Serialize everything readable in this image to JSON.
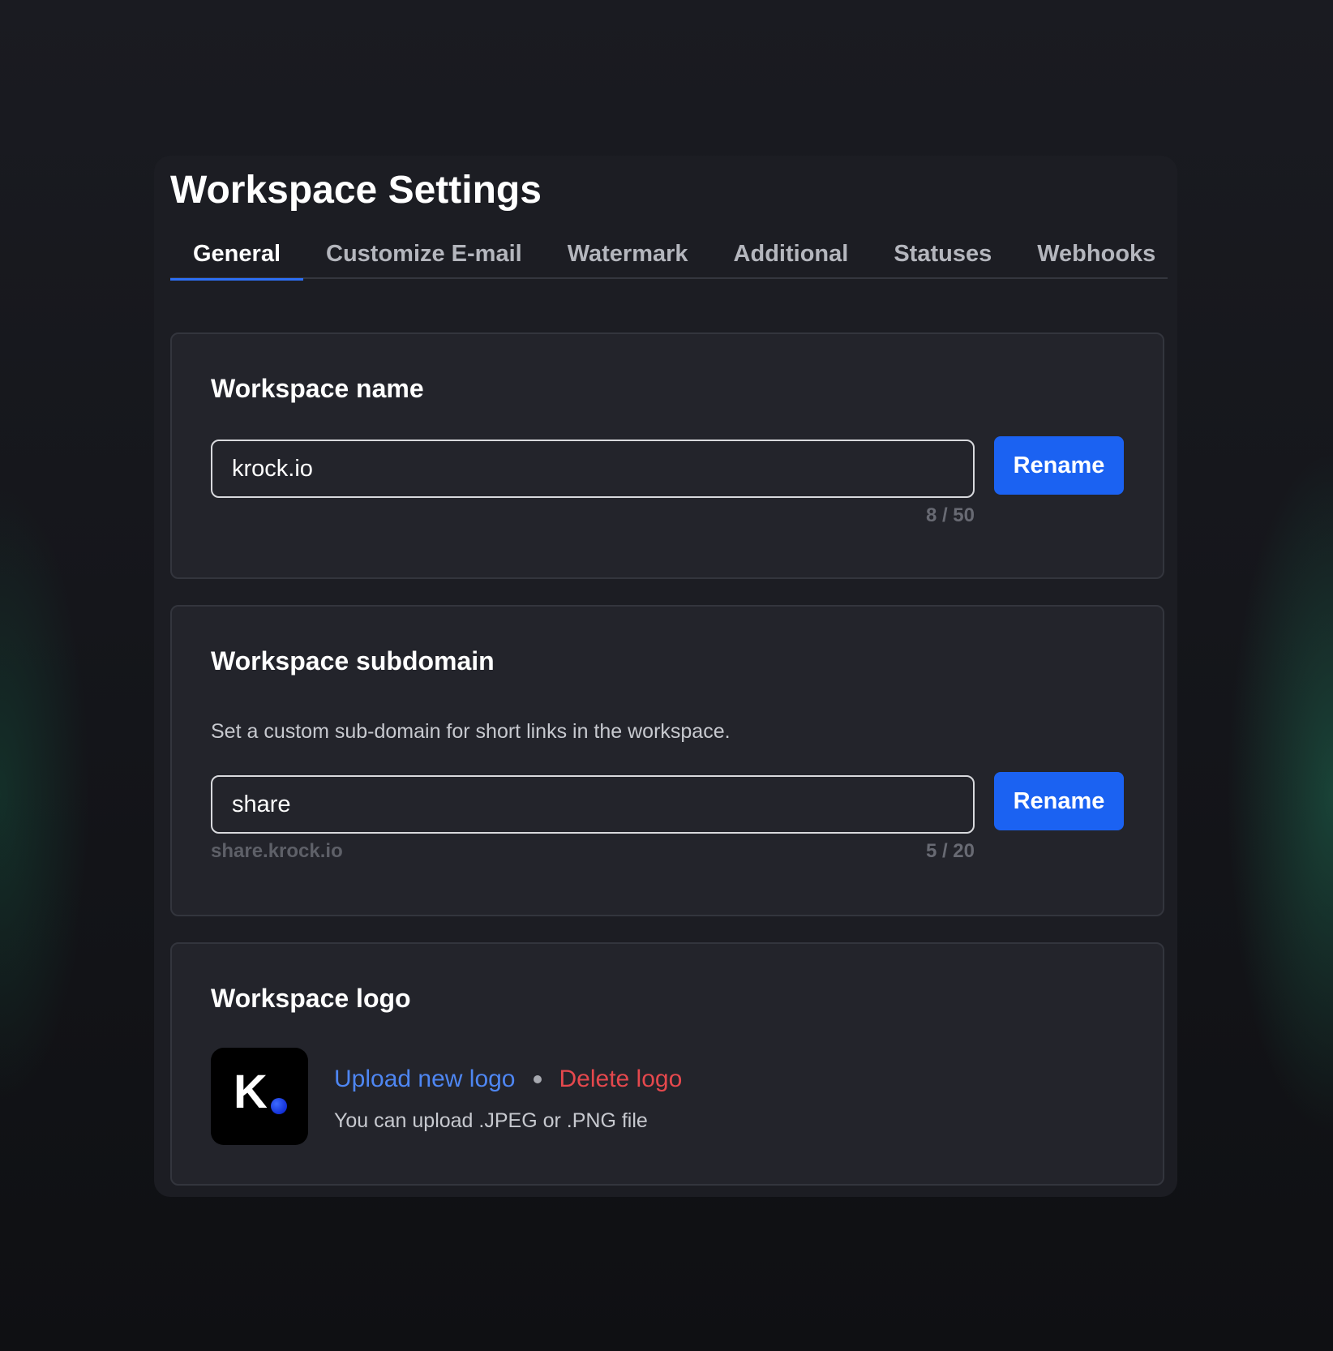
{
  "page": {
    "title": "Workspace Settings"
  },
  "tabs": [
    {
      "label": "General",
      "active": true
    },
    {
      "label": "Customize E-mail",
      "active": false
    },
    {
      "label": "Watermark",
      "active": false
    },
    {
      "label": "Additional",
      "active": false
    },
    {
      "label": "Statuses",
      "active": false
    },
    {
      "label": "Webhooks",
      "active": false
    }
  ],
  "workspace_name": {
    "title": "Workspace name",
    "value": "krock.io",
    "counter": "8 / 50",
    "button_label": "Rename"
  },
  "workspace_subdomain": {
    "title": "Workspace subdomain",
    "description": "Set a custom sub-domain for short links in the workspace.",
    "value": "share",
    "preview": "share.krock.io",
    "counter": "5 / 20",
    "button_label": "Rename"
  },
  "workspace_logo": {
    "title": "Workspace logo",
    "logo_letter": "K",
    "upload_label": "Upload new logo",
    "delete_label": "Delete logo",
    "hint": "You can upload .JPEG or .PNG file"
  },
  "colors": {
    "accent": "#1b62f2",
    "link": "#4e86f2",
    "danger": "#e5484d",
    "background": "#15161b",
    "card": "#23242b"
  }
}
